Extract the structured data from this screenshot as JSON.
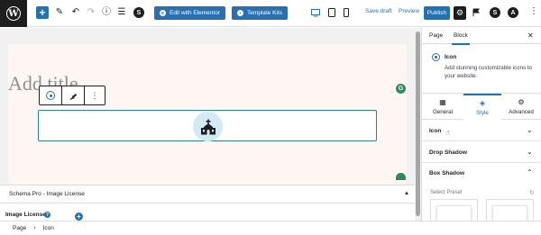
{
  "topbar": {
    "logo_letter": "W",
    "add_symbol": "+",
    "pen_icon": "✎",
    "undo_icon": "↶",
    "redo_icon": "↷",
    "info_icon": "ⓘ",
    "outline_icon": "☰",
    "elementor_button": "Edit with Elementor",
    "template_kits_button": "Template Kits",
    "save_draft": "Save draft",
    "preview": "Preview",
    "publish": "Publish",
    "settings_icon": "⚙",
    "plugin_letter_1": "S",
    "plugin_letter_2": "A",
    "more_icon": "⋮",
    "accent_color": "#2271b1"
  },
  "editor": {
    "title_placeholder": "Add title",
    "block_toolbar": {
      "transform_icon": "target-icon",
      "pin_icon": "pin-icon",
      "more_icon": "⋮"
    },
    "selected_block_icon": "church-icon",
    "grammarly_letter": "G"
  },
  "meta_box": {
    "title": "Schema Pro - Image License",
    "toggle_symbol": "▲",
    "field_label": "Image License",
    "help_symbol": "?",
    "add_symbol": "+"
  },
  "breadcrumb": {
    "items": [
      "Page",
      "Icon"
    ],
    "separator": "›"
  },
  "sidebar": {
    "tabs": [
      "Page",
      "Block"
    ],
    "active_tab": "Block",
    "close_symbol": "✕",
    "block_name": "Icon",
    "block_description": "Add stunning customizable icons to your website.",
    "style_tabs": [
      {
        "label": "General",
        "icon": "▦"
      },
      {
        "label": "Style",
        "icon": "◈"
      },
      {
        "label": "Advanced",
        "icon": "⚙"
      }
    ],
    "active_style_tab": "Style",
    "panels": [
      {
        "label": "Icon",
        "state": "collapsed",
        "chevron": "⌄"
      },
      {
        "label": "Drop Shadow",
        "state": "collapsed",
        "chevron": "⌄"
      },
      {
        "label": "Box Shadow",
        "state": "expanded",
        "chevron": "⌃"
      }
    ],
    "preset_label": "Select Preset",
    "reset_symbol": "↻"
  }
}
